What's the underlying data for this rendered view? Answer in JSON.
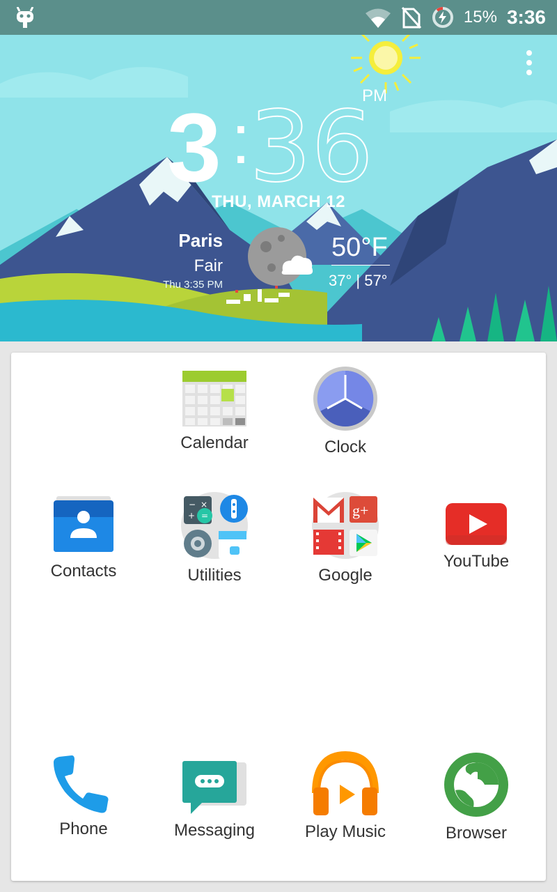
{
  "status_bar": {
    "battery_percent": "15%",
    "time": "3:36",
    "icons": [
      "cyanogenmod-icon",
      "wifi-icon",
      "no-sim-icon",
      "battery-charging-icon"
    ]
  },
  "clock_widget": {
    "hour": "3",
    "separator": ":",
    "minute": "36",
    "ampm": "PM",
    "date": "THU, MARCH 12",
    "location": "Paris",
    "condition": "Fair",
    "updated": "Thu 3:35 PM",
    "temperature": "50°F",
    "range": "37° | 57°",
    "weather_icon": "moon-cloud-icon"
  },
  "apps": {
    "calendar": "Calendar",
    "clock": "Clock",
    "contacts": "Contacts",
    "utilities": "Utilities",
    "google": "Google",
    "youtube": "YouTube",
    "phone": "Phone",
    "messaging": "Messaging",
    "play_music": "Play Music",
    "browser": "Browser"
  },
  "colors": {
    "status_bar": "#5b8f8b",
    "sky": "#8fe3e9",
    "mountain": "#3d5590",
    "grass": "#b9d43a",
    "water": "#2bb9cf"
  }
}
